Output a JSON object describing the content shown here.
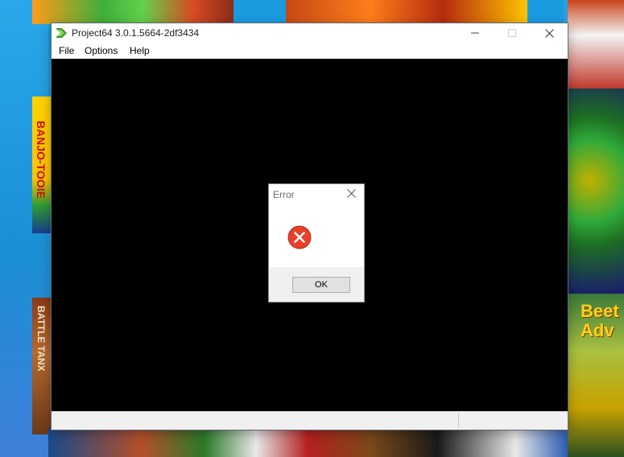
{
  "window": {
    "title": "Project64 3.0.1.5664-2df3434",
    "minimize_icon": "minimize-icon",
    "maximize_icon": "maximize-icon",
    "close_icon": "close-icon"
  },
  "menu": {
    "items": [
      {
        "label": "File"
      },
      {
        "label": "Options"
      },
      {
        "label": "Help"
      }
    ]
  },
  "status_bar": {
    "left_text": "",
    "right_text": ""
  },
  "dialog": {
    "title": "Error",
    "message": "",
    "ok_label": "OK",
    "icon": "error-icon",
    "close_icon": "close-icon"
  },
  "desktop": {
    "box_texts": {
      "banjo": "BANJO-TOOIE",
      "battle": "BATTLE TANX",
      "beetle": "Beet Adv"
    }
  },
  "colors": {
    "error_red": "#e8402a",
    "render_background": "#000000",
    "dialog_footer": "#f0f0f0",
    "button_face": "#e1e1e1"
  }
}
